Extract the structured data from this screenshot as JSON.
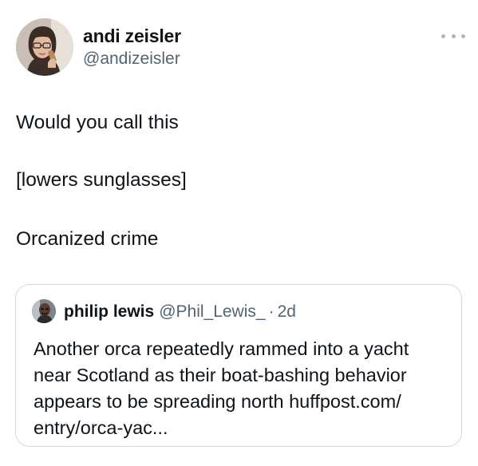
{
  "author": {
    "name": "andi zeisler",
    "handle": "@andizeisler",
    "avatar_icon": "profile-photo"
  },
  "more_icon": "ellipsis-icon",
  "tweet_lines": [
    "Would you call this",
    "[lowers sunglasses]",
    "Orcanized crime"
  ],
  "quoted": {
    "name": "philip lewis",
    "handle": "@Phil_Lewis_",
    "separator": "·",
    "time": "2d",
    "text_lines": [
      "Another orca repeatedly rammed into a yacht",
      "near Scotland as their boat-bashing behavior",
      "appears to be spreading north huffpost.com/",
      "entry/orca-yac..."
    ]
  },
  "colors": {
    "text_primary": "#0f1419",
    "text_secondary": "#536471",
    "border": "#cfd9de"
  }
}
